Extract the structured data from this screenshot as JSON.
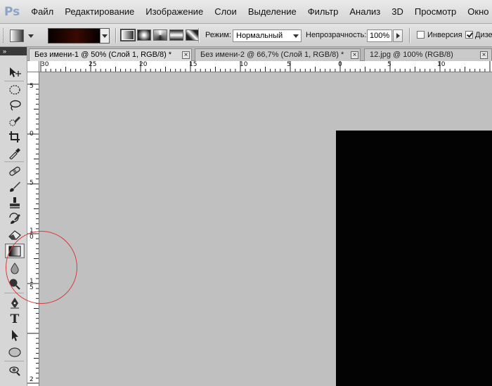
{
  "app": {
    "logo": "Ps"
  },
  "menu": [
    "Файл",
    "Редактирование",
    "Изображение",
    "Слои",
    "Выделение",
    "Фильтр",
    "Анализ",
    "3D",
    "Просмотр",
    "Окно"
  ],
  "options_bar": {
    "mode_label": "Режим:",
    "mode_value": "Нормальный",
    "opacity_label": "Непрозрачность:",
    "opacity_value": "100%",
    "invert_label": "Инверсия",
    "invert_checked": false,
    "dither_label": "Дизе",
    "dither_checked": true,
    "gradient_colors": [
      "#050000",
      "#3a0a02",
      "#050000"
    ]
  },
  "toolbar": {
    "header": "»",
    "tools": [
      {
        "name": "move-tool",
        "icon": "move-icon"
      },
      {
        "name": "marquee-tool",
        "icon": "ellipse-marquee-icon"
      },
      {
        "name": "lasso-tool",
        "icon": "lasso-icon"
      },
      {
        "name": "quick-selection-tool",
        "icon": "quick-selection-icon"
      },
      {
        "name": "crop-tool",
        "icon": "crop-icon"
      },
      {
        "name": "eyedropper-tool",
        "icon": "eyedropper-icon"
      },
      {
        "name": "healing-brush-tool",
        "icon": "bandage-icon"
      },
      {
        "name": "brush-tool",
        "icon": "brush-icon"
      },
      {
        "name": "clone-stamp-tool",
        "icon": "stamp-icon"
      },
      {
        "name": "history-brush-tool",
        "icon": "history-brush-icon"
      },
      {
        "name": "eraser-tool",
        "icon": "eraser-icon"
      },
      {
        "name": "gradient-tool",
        "icon": "gradient-icon",
        "selected": true
      },
      {
        "name": "blur-tool",
        "icon": "drop-icon"
      },
      {
        "name": "dodge-tool",
        "icon": "dodge-icon"
      },
      {
        "name": "pen-tool",
        "icon": "pen-icon"
      },
      {
        "name": "type-tool",
        "icon": "type-icon",
        "glyph": "T"
      },
      {
        "name": "path-selection-tool",
        "icon": "arrow-icon"
      },
      {
        "name": "shape-tool",
        "icon": "ellipse-shape-icon"
      },
      {
        "name": "3d-rotate-tool",
        "icon": "3d-rotate-icon"
      }
    ]
  },
  "tabs": [
    {
      "label": "Без имени-1 @ 50% (Слой 1, RGB/8) *",
      "active": true
    },
    {
      "label": "Без имени-2 @ 66,7% (Слой 1, RGB/8) *",
      "active": false
    },
    {
      "label": "12.jpg @ 100% (RGB/8)",
      "active": false
    }
  ],
  "rulers": {
    "horizontal_labels": [
      "30",
      "25",
      "20",
      "15",
      "10",
      "5",
      "0",
      "5",
      "10"
    ],
    "vertical_labels": [
      "5",
      "0",
      "5",
      "1 0",
      "1 5",
      "2"
    ]
  },
  "colors": {
    "workspace": "#c0c0c0",
    "canvas": "#030304",
    "annotation": "#d83a3a"
  }
}
